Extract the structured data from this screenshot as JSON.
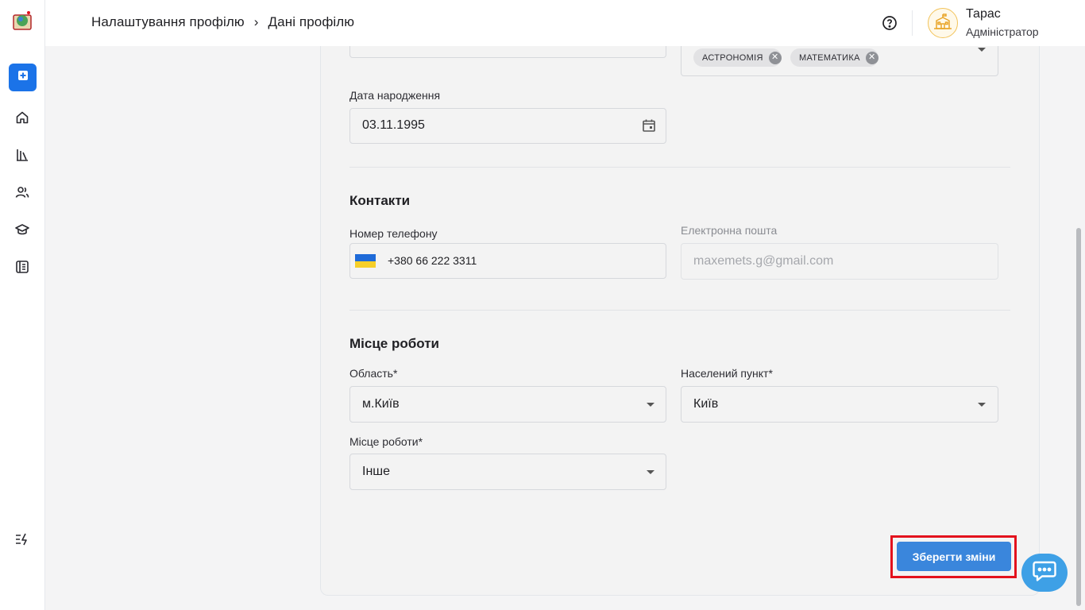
{
  "header": {
    "breadcrumb_parent": "Налаштування профілю",
    "breadcrumb_separator": "›",
    "breadcrumb_current": "Дані профілю",
    "user_name": "Тарас",
    "user_role": "Адміністратор"
  },
  "sidebar": {
    "items": [
      {
        "icon": "plus-square-icon"
      },
      {
        "icon": "home-icon"
      },
      {
        "icon": "library-icon"
      },
      {
        "icon": "users-icon"
      },
      {
        "icon": "graduation-cap-icon"
      },
      {
        "icon": "journal-icon"
      },
      {
        "icon": "collapse-menu-icon"
      }
    ]
  },
  "subjects": {
    "chips": [
      "АСТРОНОМІЯ",
      "МАТЕМАТИКА"
    ]
  },
  "birth_date": {
    "label": "Дата народження",
    "value": "03.11.1995"
  },
  "contacts": {
    "title": "Контакти",
    "phone_label": "Номер телефону",
    "phone_value": "+380 66 222 3311",
    "email_label": "Електронна пошта",
    "email_value": "maxemets.g@gmail.com"
  },
  "workplace": {
    "title": "Місце роботи",
    "region_label": "Область*",
    "region_value": "м.Київ",
    "city_label": "Населений пункт*",
    "city_value": "Київ",
    "work_label": "Місце роботи*",
    "work_value": "Інше"
  },
  "actions": {
    "save_label": "Зберегти зміни"
  },
  "colors": {
    "primary": "#1b73e8",
    "save": "#3a86dc",
    "highlight": "#e3121d",
    "chat": "#3ea0e6"
  }
}
